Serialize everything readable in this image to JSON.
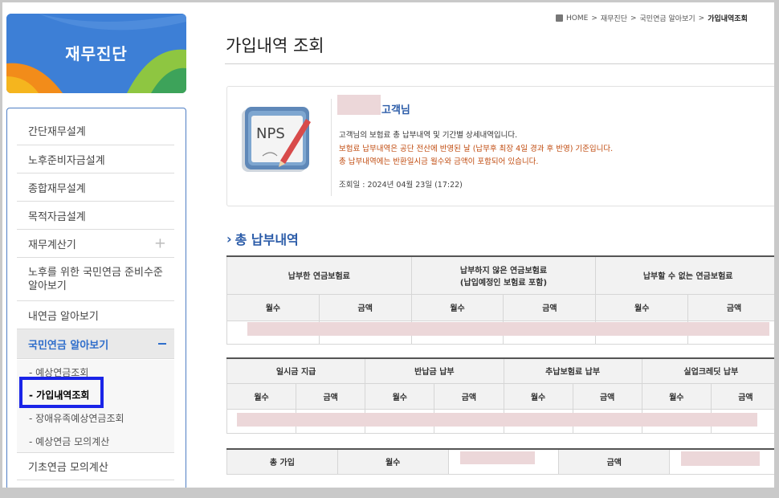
{
  "breadcrumb": {
    "items": [
      "HOME",
      "재무진단",
      "국민연금 알아보기"
    ],
    "current": "가입내역조회",
    "separator": ">"
  },
  "brand": {
    "title": "재무진단"
  },
  "sidebar": {
    "items": [
      {
        "label": "간단재무설계"
      },
      {
        "label": "노후준비자금설계"
      },
      {
        "label": "종합재무설계"
      },
      {
        "label": "목적자금설계"
      },
      {
        "label": "재무계산기",
        "toggle": "+"
      },
      {
        "label": "노후를 위한 국민연금 준비수준 알아보기"
      },
      {
        "label": "내연금 알아보기"
      },
      {
        "label": "국민연금 알아보기",
        "active": true
      },
      {
        "label": "기초연금 모의계산"
      }
    ],
    "subitems": [
      {
        "label": "- 예상연금조회"
      },
      {
        "label": "- 가입내역조회",
        "selected": true
      },
      {
        "label": "- 장애유족예상연금조회"
      },
      {
        "label": "- 예상연금 모의계산"
      }
    ]
  },
  "page": {
    "title": "가입내역 조회"
  },
  "info_card": {
    "icon_text": "NPS",
    "customer_suffix": "고객님",
    "line1": "고객님의 보험료 총 납부내역 및 기간별 상세내역입니다.",
    "line2": "보험료 납부내역은 공단 전산에 반영된 날 (납부후 최장 4일 경과 후 반영) 기준입니다.",
    "line3": "총 납부내역에는 반환일시금 월수와 금액이 포함되어 있습니다.",
    "lookup_date": "조회일 : 2024년 04월 23일 (17:22)"
  },
  "section": {
    "title": "총 납부내역"
  },
  "table1": {
    "groups": [
      "납부한 연금보험료",
      "납부하지 않은 연금보험료\n(납입예정인 보험료 포함)",
      "납부할 수 없는 연금보험료"
    ],
    "sub": [
      "월수",
      "금액",
      "월수",
      "금액",
      "월수",
      "금액"
    ]
  },
  "table2": {
    "groups": [
      "일시금 지급",
      "반납금 납부",
      "추납보험료 납부",
      "실업크레딧 납부"
    ],
    "sub": [
      "월수",
      "금액",
      "월수",
      "금액",
      "월수",
      "금액",
      "월수",
      "금액"
    ]
  },
  "table3": {
    "cells": [
      "총 가입",
      "월수",
      "금액"
    ]
  },
  "colors": {
    "brand_blue": "#3d7fd6",
    "link_blue": "#2a5ba8",
    "warn_orange": "#c04a0d",
    "highlight": "#1a24e8",
    "redaction": "#ecd7d9"
  }
}
